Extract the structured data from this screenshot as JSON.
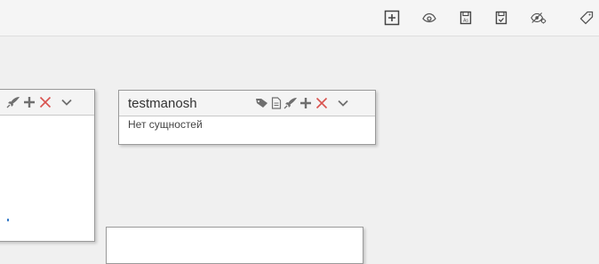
{
  "toolbar": {
    "icons": [
      "add-square-icon",
      "eye-outline-icon",
      "save-document-icon",
      "save-check-icon",
      "eye-cog-icon",
      "tag-icon"
    ]
  },
  "cards": {
    "testmanosh": {
      "title": "testmanosh",
      "empty_text": "Нет сущностей",
      "icons": [
        "tag-icon",
        "document-icon",
        "rocket-icon",
        "plus-icon",
        "close-icon",
        "chevron-down-icon"
      ]
    },
    "left": {
      "icons": [
        "rocket-icon",
        "plus-icon",
        "close-icon",
        "chevron-down-icon"
      ]
    }
  },
  "colors": {
    "icon": "#6f6f6f",
    "close": "#d9534f",
    "accent": "#3b7ec9"
  }
}
